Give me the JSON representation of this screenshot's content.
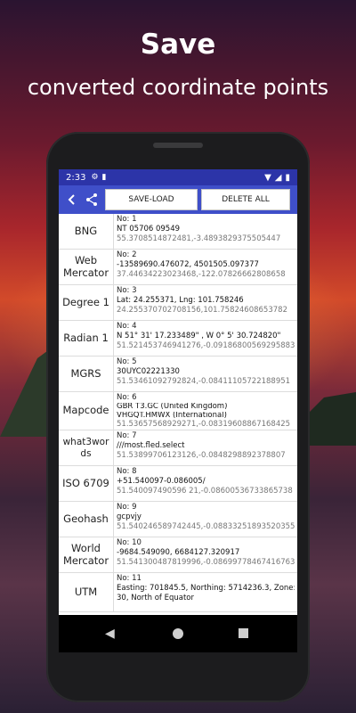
{
  "promo": {
    "title": "Save",
    "subtitle": "converted coordinate points"
  },
  "status_bar": {
    "time": "2:33"
  },
  "toolbar": {
    "save_load_label": "SAVE-LOAD",
    "delete_all_label": "DELETE ALL"
  },
  "rows": [
    {
      "label": "BNG",
      "num": "No: 1",
      "value": "NT 05706 09549",
      "latlng": "55.3708514872481,-3.4893829375505447"
    },
    {
      "label": "Web Mercator",
      "num": "No: 2",
      "value": "-13589690.476072, 4501505.097377",
      "latlng": "37.44634223023468,-122.07826662808658"
    },
    {
      "label": "Degree 1",
      "num": "No: 3",
      "value": "Lat: 24.255371, Lng: 101.758246",
      "latlng": "24.255370702708156,101.75824608653782"
    },
    {
      "label": "Radian 1",
      "num": "No: 4",
      "value": "N 51° 31' 17.233489\" , W 0° 5' 30.724820\"",
      "latlng": "51.521453746941276,-0.09186800569295883"
    },
    {
      "label": "MGRS",
      "num": "No: 5",
      "value": "30UYC02221330",
      "latlng": "51.53461092792824,-0.08411105722188951"
    },
    {
      "label": "Mapcode",
      "num": "No: 6",
      "value": "GBR T3.GC (United Kingdom)",
      "value2": "VHGQT.HMWX (International)",
      "latlng": "51.53657568929271,-0.08319608867168425"
    },
    {
      "label": "what3words",
      "num": "No: 7",
      "value": "///most.fled.select",
      "latlng": "51.53899706123126,-0.0848298892378807"
    },
    {
      "label": "ISO 6709",
      "num": "No: 8",
      "value": "+51.540097-0.086005/",
      "latlng": "51.540097490596 21,-0.08600536733865738"
    },
    {
      "label": "Geohash",
      "num": "No: 9",
      "value": "gcpvjy",
      "latlng": "51.540246589742445,-0.08833251893520355"
    },
    {
      "label": "World Mercator",
      "num": "No: 10",
      "value": "-9684.549090, 6684127.320917",
      "latlng": "51.541300487819996,-0.08699778467416763"
    },
    {
      "label": "UTM",
      "num": "No: 11",
      "value": "Easting: 701845.5, Northing: 5714236.3, Zone:",
      "value2": "30, North of Equator",
      "latlng": ""
    }
  ],
  "colors": {
    "status_bar": "#2c34a8",
    "app_bar": "#3f4fc9"
  }
}
